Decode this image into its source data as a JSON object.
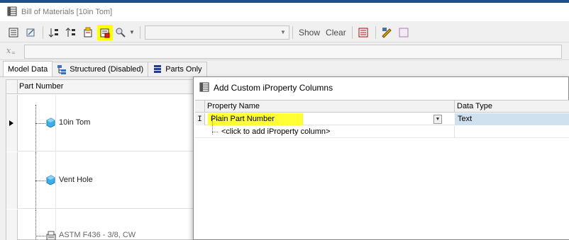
{
  "window": {
    "title": "Bill of Materials [10in Tom]"
  },
  "toolbar": {
    "show_label": "Show",
    "clear_label": "Clear",
    "highlight_color": "#ffff00",
    "icons": [
      "bom-settings-icon",
      "edit-icon",
      "sort-ascending-icon",
      "sort-descending-icon",
      "export-icon",
      "add-custom-iproperty-columns-icon",
      "find-icon",
      "find-dropdown-icon",
      "filter-combo",
      "column-chooser-icon",
      "edit-properties-icon",
      "view-icon"
    ]
  },
  "formula_bar": {
    "icon": "fx-icon"
  },
  "tabs": [
    {
      "label": "Model Data",
      "icon": ""
    },
    {
      "label": "Structured (Disabled)",
      "icon": "structured-icon"
    },
    {
      "label": "Parts Only",
      "icon": "parts-only-icon"
    }
  ],
  "grid": {
    "column_header": "Part Number",
    "rows": [
      {
        "label": "10in Tom",
        "icon": "part-cube-icon"
      },
      {
        "label": "Vent Hole",
        "icon": "part-cube-icon"
      },
      {
        "label": "ASTM F436 - 3/8, CW",
        "icon": "library-part-icon"
      }
    ]
  },
  "dialog": {
    "title": "Add Custom iProperty Columns",
    "columns": [
      "Property Name",
      "Data Type"
    ],
    "rows": [
      {
        "property_name": "Plain Part Number",
        "data_type": "Text",
        "row_marker": "I"
      }
    ],
    "add_row_text": "<click to add iProperty column>",
    "highlight_color": "#ffff33",
    "selected_cell_color": "#cfe0ef"
  }
}
